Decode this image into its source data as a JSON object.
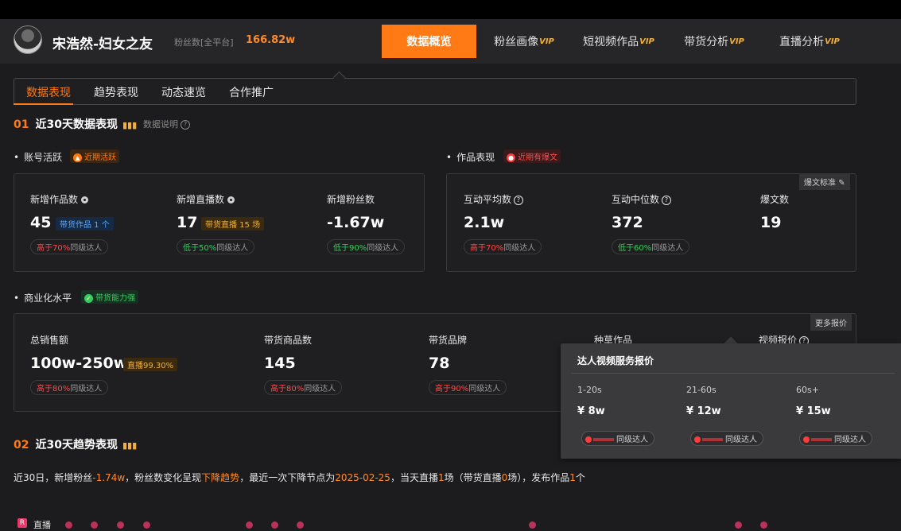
{
  "header": {
    "creator_name": "宋浩然-妇女之友",
    "fans_label": "粉丝数[全平台]",
    "fans_value": "166.82w",
    "nav": [
      {
        "label": "数据概览",
        "vip": "",
        "active": true
      },
      {
        "label": "粉丝画像",
        "vip": "VIP"
      },
      {
        "label": "短视频作品",
        "vip": "VIP"
      },
      {
        "label": "带货分析",
        "vip": "VIP"
      },
      {
        "label": "直播分析",
        "vip": "VIP"
      }
    ]
  },
  "subtabs": [
    "数据表现",
    "趋势表现",
    "动态速览",
    "合作推广"
  ],
  "section1": {
    "num": "01",
    "title": "近30天数据表现",
    "note": "数据说明",
    "account": {
      "label": "账号活跃",
      "badge": "近期活跃",
      "new_works_label": "新增作品数",
      "new_works_value": "45",
      "new_works_tag": "带货作品 1 个",
      "new_works_cmp_prefix": "高于",
      "new_works_cmp_pct": "70%",
      "new_works_cmp_suffix": "同级达人",
      "new_live_label": "新增直播数",
      "new_live_value": "17",
      "new_live_tag": "带货直播 15 场",
      "new_live_cmp_prefix": "低于",
      "new_live_cmp_pct": "50%",
      "new_live_cmp_suffix": "同级达人",
      "new_fans_label": "新增粉丝数",
      "new_fans_value": "-1.67w",
      "new_fans_cmp_prefix": "低于",
      "new_fans_cmp_pct": "90%",
      "new_fans_cmp_suffix": "同级达人"
    },
    "works": {
      "label": "作品表现",
      "badge": "近期有爆文",
      "corner_button": "爆文标准",
      "avg_label": "互动平均数",
      "avg_value": "2.1w",
      "avg_cmp_prefix": "高于",
      "avg_cmp_pct": "70%",
      "avg_cmp_suffix": "同级达人",
      "median_label": "互动中位数",
      "median_value": "372",
      "median_cmp_prefix": "低于",
      "median_cmp_pct": "60%",
      "median_cmp_suffix": "同级达人",
      "viral_label": "爆文数",
      "viral_value": "19"
    },
    "commerce": {
      "label": "商业化水平",
      "badge": "带货能力强",
      "corner_button": "更多报价",
      "sales_label": "总销售额",
      "sales_value": "100w-250w",
      "sales_tag": "直播99.30%",
      "sales_cmp_prefix": "高于",
      "sales_cmp_pct": "80%",
      "sales_cmp_suffix": "同级达人",
      "goods_label": "带货商品数",
      "goods_value": "145",
      "goods_cmp_prefix": "高于",
      "goods_cmp_pct": "80%",
      "goods_cmp_suffix": "同级达人",
      "brands_label": "带货品牌",
      "brands_value": "78",
      "brands_cmp_prefix": "高于",
      "brands_cmp_pct": "90%",
      "brands_cmp_suffix": "同级达人",
      "seeding_label": "种草作品",
      "video_price_label": "视频报价"
    }
  },
  "popup": {
    "title": "达人视频服务报价",
    "items": [
      {
        "range": "1-20s",
        "price": "¥ 8w",
        "cmp": "同级达人"
      },
      {
        "range": "21-60s",
        "price": "¥ 12w",
        "cmp": "同级达人"
      },
      {
        "range": "60s+",
        "price": "¥ 15w",
        "cmp": "同级达人"
      }
    ]
  },
  "section2": {
    "num": "02",
    "title": "近30天趋势表现",
    "summary": {
      "p1": "近30日，新增粉丝",
      "v1": "-1.74w",
      "p2": "，粉丝数变化呈现",
      "v2": "下降趋势",
      "p3": "，最近一次下降节点为",
      "v3": "2025-02-25",
      "p4": "，当天直播",
      "v4": "1",
      "p5": "场（带货直播",
      "v5": "0",
      "p6": "场），发布作品",
      "v6": "1",
      "p7": "个"
    },
    "legend_label": "直播"
  },
  "colors": {
    "accent": "#ff7a14",
    "up": "#ff4a4a",
    "down": "#3acb5e",
    "vip": "#f2b03a"
  }
}
